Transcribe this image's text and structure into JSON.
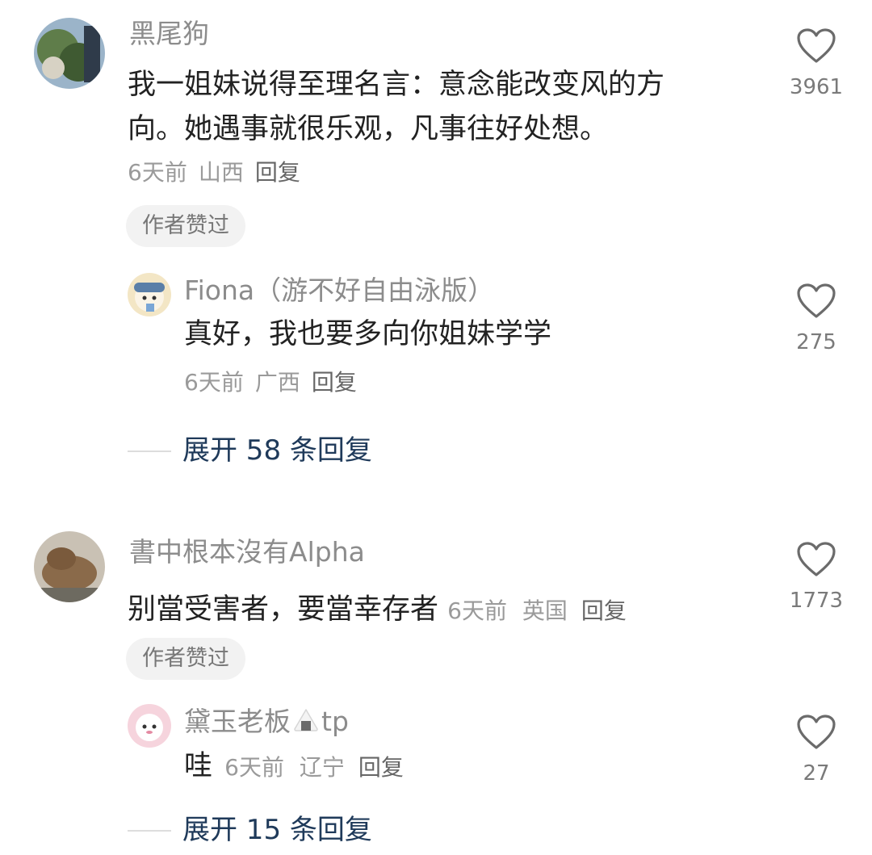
{
  "comments": [
    {
      "username": "黑尾狗",
      "text_line1": "我一姐妹说得至理名言：意念能改变风的方",
      "text_line2": "向。她遇事就很乐观，凡事往好处想。",
      "time": "6天前",
      "location": "山西",
      "reply": "回复",
      "badge": "作者赞过",
      "likes": "3961",
      "replies": [
        {
          "username": "Fiona（游不好自由泳版）",
          "text": "真好，我也要多向你姐妹学学",
          "time": "6天前",
          "location": "广西",
          "reply": "回复",
          "likes": "275"
        }
      ],
      "expand": "展开 58 条回复"
    },
    {
      "username": "書中根本沒有Alpha",
      "text": "别當受害者，要當幸存者",
      "time": "6天前",
      "location": "英国",
      "reply": "回复",
      "badge": "作者赞过",
      "likes": "1773",
      "replies": [
        {
          "username_prefix": "黛玉老板",
          "username_suffix": "tp",
          "text": "哇",
          "time": "6天前",
          "location": "辽宁",
          "reply": "回复",
          "likes": "27"
        }
      ],
      "expand": "展开 15 条回复"
    }
  ],
  "icons": {
    "like": "heart-outline-icon",
    "onigiri": "rice-ball-icon"
  },
  "colors": {
    "username": "#8c8c8c",
    "text": "#222222",
    "expand": "#1f3a5a"
  }
}
